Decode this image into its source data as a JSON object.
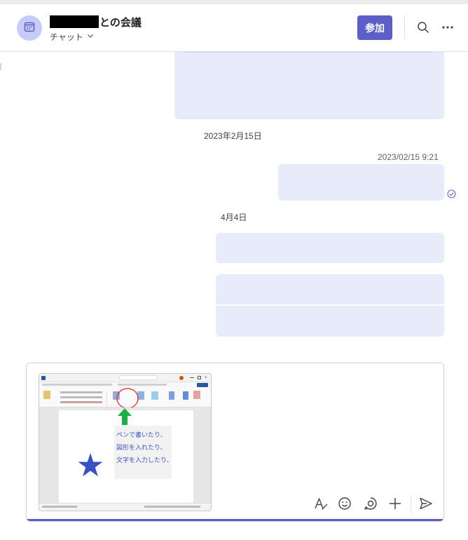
{
  "header": {
    "title_suffix": "との会議",
    "subtitle": "チャット",
    "join_label": "参加",
    "icons": [
      "calendar-icon",
      "chevron-down-icon",
      "search-icon",
      "more-icon"
    ],
    "accent": "#5b5fc7"
  },
  "chat": {
    "date_separators": [
      "2023年2月15日",
      "4月4日"
    ],
    "sent_timestamp": "2023/02/15 9:21",
    "bubble_color": "#e8ebfa"
  },
  "composer": {
    "attachment_text": [
      "ペンで書いたり、",
      "図形を入れたり、",
      "文字を入力したり、"
    ],
    "tools": [
      "format-icon",
      "emoji-icon",
      "loop-icon",
      "add-icon",
      "send-icon"
    ]
  }
}
